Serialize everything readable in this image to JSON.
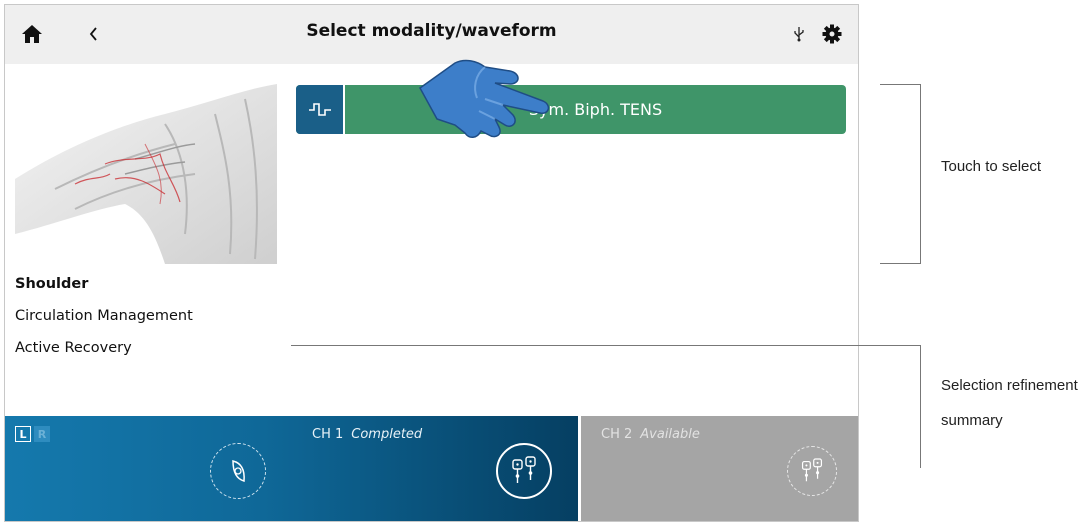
{
  "header": {
    "title": "Select modality/waveform"
  },
  "icons": {
    "home": "home-icon",
    "back": "chevron-left-icon",
    "usb": "usb-icon",
    "settings": "gear-icon"
  },
  "left_panel": {
    "body_part": "Shoulder",
    "lines": [
      "Circulation Management",
      "Active Recovery"
    ]
  },
  "waveform_option": {
    "label": "Sym. Biph. TENS"
  },
  "channels": {
    "ch1": {
      "name": "CH 1",
      "status": "Completed",
      "sides": [
        "L",
        "R"
      ],
      "active_side": "L"
    },
    "ch2": {
      "name": "CH 2",
      "status": "Available"
    }
  },
  "annotations": {
    "touch": "Touch to select",
    "summary_line1": "Selection refinement",
    "summary_line2": "summary"
  },
  "colors": {
    "option_green": "#3f9569",
    "wave_icon_blue": "#1a5f88",
    "ch1_blue": "#1579ad",
    "ch2_grey": "#a5a5a5"
  }
}
